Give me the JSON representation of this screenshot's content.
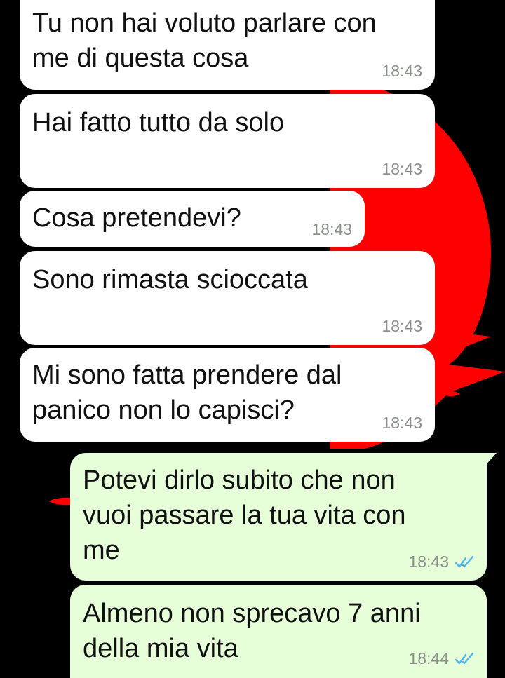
{
  "colors": {
    "wallpaper": "#000000",
    "accent_red": "#ff0000",
    "incoming_bubble": "#ffffff",
    "outgoing_bubble": "#e6ffd9",
    "read_tick": "#4fb6ec",
    "timestamp": "#8a8f8a"
  },
  "messages": [
    {
      "direction": "incoming",
      "text": "Tu non hai voluto parlare con\nme di questa cosa",
      "time": "18:43"
    },
    {
      "direction": "incoming",
      "text": "Hai fatto tutto da solo",
      "time": "18:43"
    },
    {
      "direction": "incoming",
      "text": "Cosa pretendevi?",
      "time": "18:43"
    },
    {
      "direction": "incoming",
      "text": "Sono rimasta scioccata",
      "time": "18:43"
    },
    {
      "direction": "incoming",
      "text": "Mi sono fatta prendere dal\npanico non lo capisci?",
      "time": "18:43"
    },
    {
      "direction": "outgoing",
      "text": "Potevi dirlo subito che non\nvuoi passare la tua vita con\nme",
      "time": "18:43",
      "status_icon": "double-check-read-icon"
    },
    {
      "direction": "outgoing",
      "text": "Almeno non sprecavo 7 anni\ndella mia vita",
      "time": "18:44",
      "status_icon": "double-check-read-icon"
    }
  ]
}
